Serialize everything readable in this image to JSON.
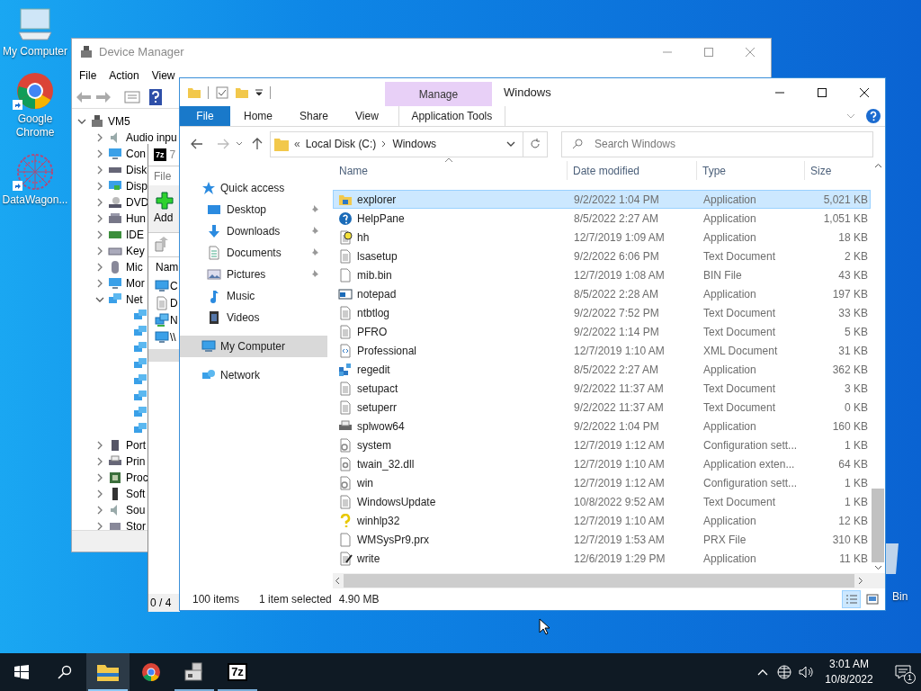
{
  "desktop_icons": [
    {
      "label": "My Computer",
      "kind": "computer"
    },
    {
      "label": "Google Chrome",
      "kind": "chrome"
    },
    {
      "label": "DataWagon...",
      "kind": "datawagon"
    }
  ],
  "recycle_bin": {
    "label": "Bin"
  },
  "device_manager": {
    "title": "Device Manager",
    "menu": [
      "File",
      "Action",
      "View"
    ],
    "tree": {
      "label": "VM5",
      "expanded": true,
      "children": [
        {
          "label": "Audio inpu",
          "kind": "audio",
          "expanded": false
        },
        {
          "label": "Con",
          "kind": "monitor",
          "expanded": false
        },
        {
          "label": "Disk",
          "kind": "disk",
          "expanded": false
        },
        {
          "label": "Disp",
          "kind": "display",
          "expanded": false
        },
        {
          "label": "DVD",
          "kind": "dvd",
          "expanded": false
        },
        {
          "label": "Hun",
          "kind": "hid",
          "expanded": false
        },
        {
          "label": "IDE",
          "kind": "ide",
          "expanded": false
        },
        {
          "label": "Key",
          "kind": "keyboard",
          "expanded": false
        },
        {
          "label": "Mic",
          "kind": "mouse",
          "expanded": false
        },
        {
          "label": "Mor",
          "kind": "monitor",
          "expanded": false
        },
        {
          "label": "Net",
          "kind": "network",
          "expanded": true,
          "children": [
            {
              "kind": "network"
            },
            {
              "kind": "network"
            },
            {
              "kind": "network"
            },
            {
              "kind": "network"
            },
            {
              "kind": "network"
            },
            {
              "kind": "network"
            },
            {
              "kind": "network"
            },
            {
              "kind": "network"
            }
          ]
        },
        {
          "label": "Port",
          "kind": "port",
          "expanded": false
        },
        {
          "label": "Prin",
          "kind": "printer",
          "expanded": false
        },
        {
          "label": "Proc",
          "kind": "chip",
          "expanded": false
        },
        {
          "label": "Soft",
          "kind": "tower",
          "expanded": false
        },
        {
          "label": "Sou",
          "kind": "audio",
          "expanded": false
        },
        {
          "label": "Stor",
          "kind": "storage",
          "expanded": false
        }
      ]
    }
  },
  "sevenzip": {
    "logo": "7z",
    "title": "7",
    "menu": [
      "File"
    ],
    "toolbar": [
      "Add"
    ],
    "column": "Nam",
    "rows": [
      {
        "name": "C",
        "kind": "computer"
      },
      {
        "name": "D",
        "kind": "document"
      },
      {
        "name": "N",
        "kind": "network"
      },
      {
        "name": "\\\\",
        "kind": "computer"
      }
    ],
    "status": "0 / 4"
  },
  "explorer": {
    "title": "Windows",
    "context_group": "Manage",
    "tabs": [
      {
        "label": "File",
        "kind": "file"
      },
      {
        "label": "Home",
        "kind": "tab"
      },
      {
        "label": "Share",
        "kind": "tab"
      },
      {
        "label": "View",
        "kind": "tab"
      },
      {
        "label": "Application Tools",
        "kind": "context"
      }
    ],
    "address": {
      "overflow": "«",
      "segments": [
        "Local Disk (C:)",
        "Windows"
      ]
    },
    "search": {
      "placeholder": "Search Windows"
    },
    "nav": [
      {
        "label": "Quick access",
        "kind": "star",
        "selected": false,
        "children": [
          {
            "label": "Desktop",
            "kind": "desktop",
            "pinned": true,
            "selected": false
          },
          {
            "label": "Downloads",
            "kind": "downloads",
            "pinned": true,
            "selected": false
          },
          {
            "label": "Documents",
            "kind": "documents",
            "pinned": true,
            "selected": false
          },
          {
            "label": "Pictures",
            "kind": "pictures",
            "pinned": true,
            "selected": false
          },
          {
            "label": "Music",
            "kind": "music",
            "pinned": false,
            "selected": false
          },
          {
            "label": "Videos",
            "kind": "videos",
            "pinned": false,
            "selected": false
          }
        ]
      },
      {
        "label": "My Computer",
        "kind": "computer",
        "selected": true
      },
      {
        "label": "Network",
        "kind": "network",
        "selected": false
      }
    ],
    "columns": [
      "Name",
      "Date modified",
      "Type",
      "Size"
    ],
    "rows": [
      {
        "name": "explorer",
        "date": "9/2/2022 1:04 PM",
        "type": "Application",
        "size": "5,021 KB",
        "kind": "explorer",
        "selected": true
      },
      {
        "name": "HelpPane",
        "date": "8/5/2022 2:27 AM",
        "type": "Application",
        "size": "1,051 KB",
        "kind": "help",
        "selected": false
      },
      {
        "name": "hh",
        "date": "12/7/2019 1:09 AM",
        "type": "Application",
        "size": "18 KB",
        "kind": "hh",
        "selected": false
      },
      {
        "name": "lsasetup",
        "date": "9/2/2022 6:06 PM",
        "type": "Text Document",
        "size": "2 KB",
        "kind": "text",
        "selected": false
      },
      {
        "name": "mib.bin",
        "date": "12/7/2019 1:08 AM",
        "type": "BIN File",
        "size": "43 KB",
        "kind": "blank",
        "selected": false
      },
      {
        "name": "notepad",
        "date": "8/5/2022 2:28 AM",
        "type": "Application",
        "size": "197 KB",
        "kind": "notepad",
        "selected": false
      },
      {
        "name": "ntbtlog",
        "date": "9/2/2022 7:52 PM",
        "type": "Text Document",
        "size": "33 KB",
        "kind": "text",
        "selected": false
      },
      {
        "name": "PFRO",
        "date": "9/2/2022 1:14 PM",
        "type": "Text Document",
        "size": "5 KB",
        "kind": "text",
        "selected": false
      },
      {
        "name": "Professional",
        "date": "12/7/2019 1:10 AM",
        "type": "XML Document",
        "size": "31 KB",
        "kind": "xml",
        "selected": false
      },
      {
        "name": "regedit",
        "date": "8/5/2022 2:27 AM",
        "type": "Application",
        "size": "362 KB",
        "kind": "regedit",
        "selected": false
      },
      {
        "name": "setupact",
        "date": "9/2/2022 11:37 AM",
        "type": "Text Document",
        "size": "3 KB",
        "kind": "text",
        "selected": false
      },
      {
        "name": "setuperr",
        "date": "9/2/2022 11:37 AM",
        "type": "Text Document",
        "size": "0 KB",
        "kind": "text",
        "selected": false
      },
      {
        "name": "splwow64",
        "date": "9/2/2022 1:04 PM",
        "type": "Application",
        "size": "160 KB",
        "kind": "printer",
        "selected": false
      },
      {
        "name": "system",
        "date": "12/7/2019 1:12 AM",
        "type": "Configuration sett...",
        "size": "1 KB",
        "kind": "config",
        "selected": false
      },
      {
        "name": "twain_32.dll",
        "date": "12/7/2019 1:10 AM",
        "type": "Application exten...",
        "size": "64 KB",
        "kind": "dll",
        "selected": false
      },
      {
        "name": "win",
        "date": "12/7/2019 1:12 AM",
        "type": "Configuration sett...",
        "size": "1 KB",
        "kind": "config",
        "selected": false
      },
      {
        "name": "WindowsUpdate",
        "date": "10/8/2022 9:52 AM",
        "type": "Text Document",
        "size": "1 KB",
        "kind": "text",
        "selected": false
      },
      {
        "name": "winhlp32",
        "date": "12/7/2019 1:10 AM",
        "type": "Application",
        "size": "12 KB",
        "kind": "question",
        "selected": false
      },
      {
        "name": "WMSysPr9.prx",
        "date": "12/7/2019 1:53 AM",
        "type": "PRX File",
        "size": "310 KB",
        "kind": "blank",
        "selected": false
      },
      {
        "name": "write",
        "date": "12/6/2019 1:29 PM",
        "type": "Application",
        "size": "11 KB",
        "kind": "write",
        "selected": false
      }
    ],
    "status": {
      "items": "100 items",
      "selection": "1 item selected",
      "size": "4.90 MB"
    },
    "views": [
      {
        "kind": "details",
        "selected": true
      },
      {
        "kind": "large",
        "selected": false
      }
    ]
  },
  "taskbar": {
    "apps": [
      {
        "kind": "explorer",
        "active": true,
        "running": true
      },
      {
        "kind": "chrome",
        "active": false,
        "running": false
      },
      {
        "kind": "server",
        "active": false,
        "running": true
      },
      {
        "kind": "sevenzip",
        "label": "7z",
        "active": false,
        "running": true
      }
    ],
    "time": "3:01 AM",
    "date": "10/8/2022",
    "notifications": "1"
  }
}
